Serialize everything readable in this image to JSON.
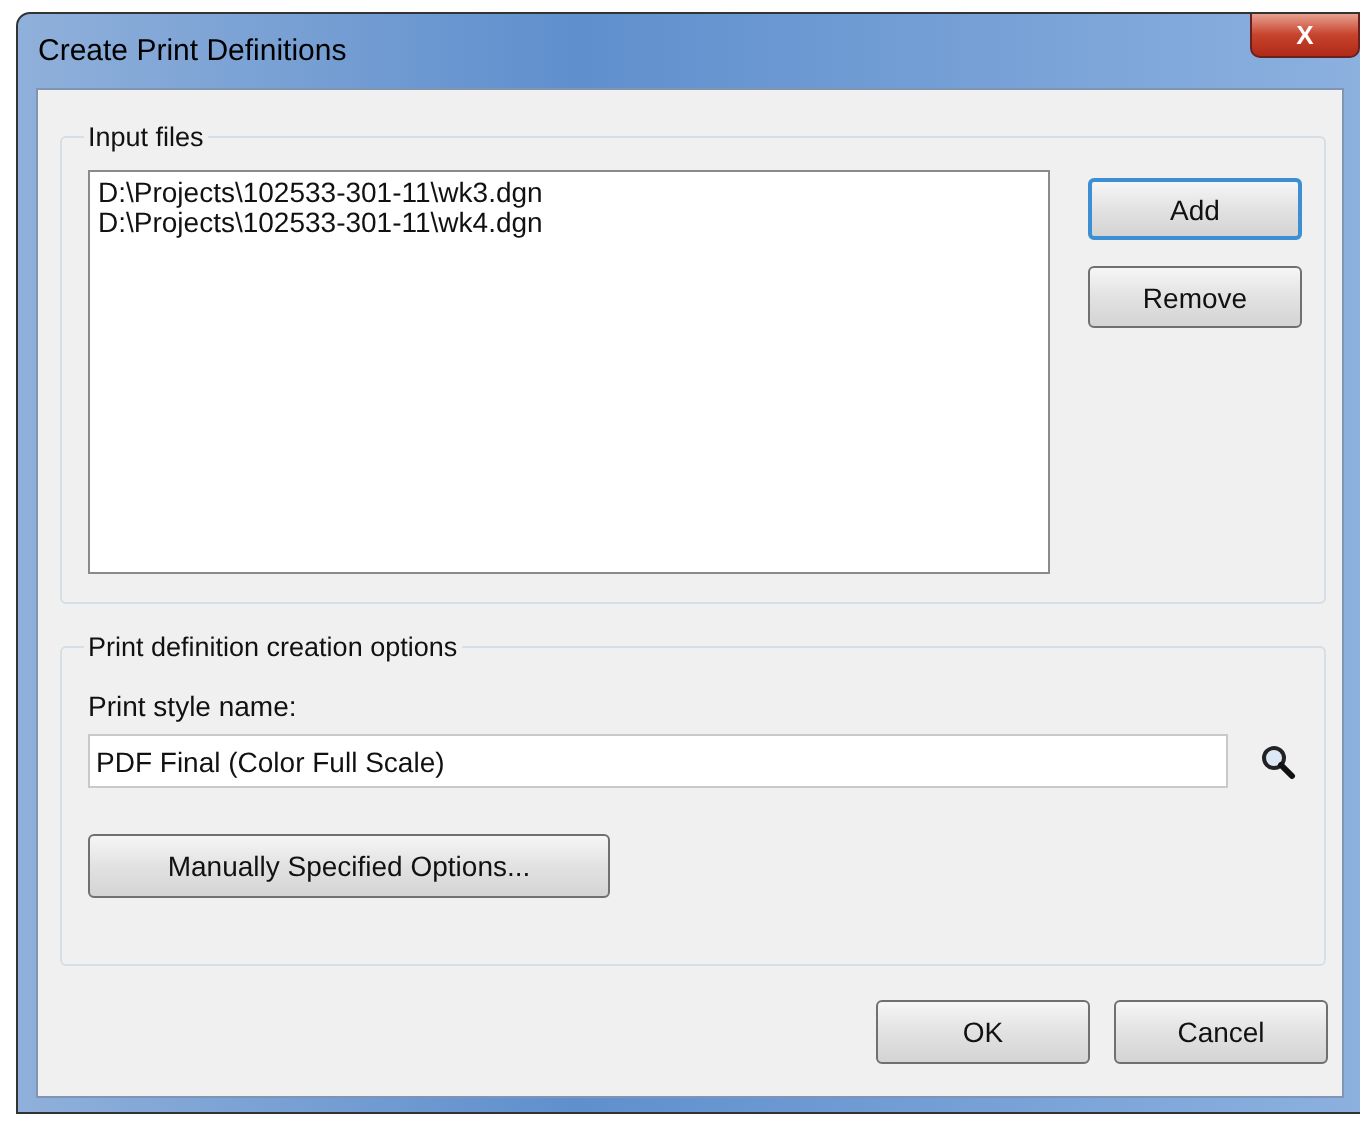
{
  "window": {
    "title": "Create Print Definitions",
    "close_label": "X"
  },
  "input_files": {
    "title": "Input files",
    "files": [
      "D:\\Projects\\102533-301-11\\wk3.dgn",
      "D:\\Projects\\102533-301-11\\wk4.dgn"
    ],
    "buttons": [
      {
        "label": "Add",
        "default": true
      },
      {
        "label": "Remove",
        "default": false
      }
    ]
  },
  "options": {
    "title": "Print definition creation options",
    "style_label": "Print style name:",
    "style_value": "PDF Final (Color Full Scale)",
    "manual_button": "Manually Specified Options..."
  },
  "buttons": [
    "OK",
    "Cancel"
  ]
}
